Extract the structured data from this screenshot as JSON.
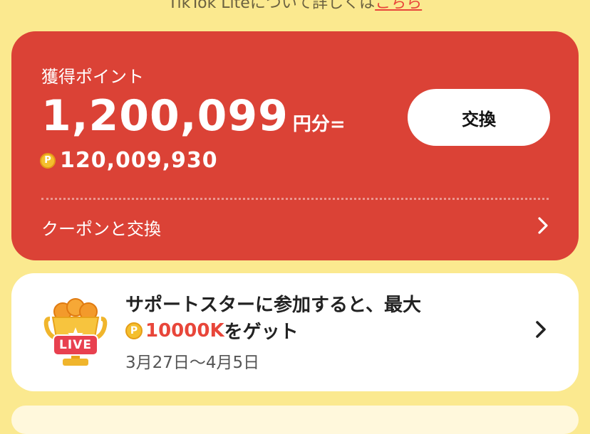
{
  "top_note": {
    "text": "TikTok Liteについて詳しくは",
    "link": "こちら"
  },
  "points_card": {
    "label": "獲得ポイント",
    "amount": "1,200,099",
    "amount_unit": "円分=",
    "coin_symbol": "P",
    "points": "120,009,930",
    "exchange_button": "交換",
    "coupon_label": "クーポンと交換"
  },
  "promo_card": {
    "badge": "LIVE",
    "title": "サポートスターに参加すると、最大",
    "coin_symbol": "P",
    "amount": "10000K",
    "suffix": "をゲット",
    "dates": "3月27日〜4月5日"
  },
  "colors": {
    "background": "#fbe98f",
    "card_red": "#db4236",
    "accent_red": "#e8463a",
    "coin_gold": "#f4bf2e"
  },
  "icons": [
    "coin-icon",
    "chevron-right-icon",
    "trophy-icon"
  ]
}
